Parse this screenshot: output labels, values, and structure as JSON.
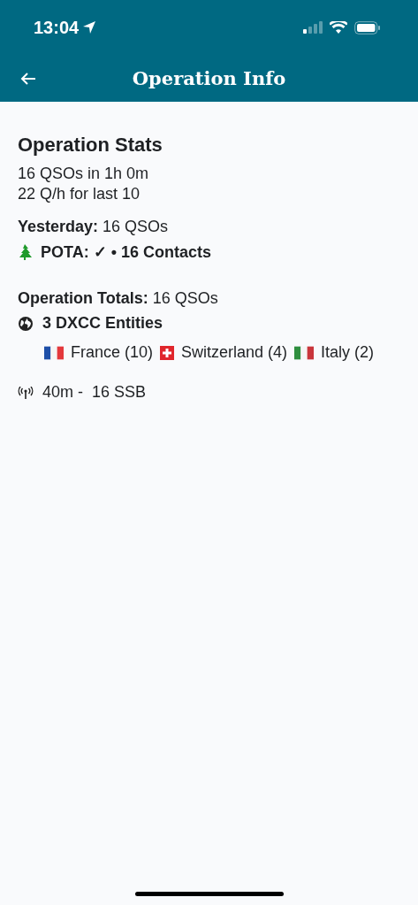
{
  "status_bar": {
    "time": "13:04"
  },
  "header": {
    "title": "Operation Info"
  },
  "stats": {
    "title": "Operation Stats",
    "lines": [
      "16 QSOs in 1h 0m",
      "22 Q/h for last 10"
    ]
  },
  "yesterday": {
    "summary": "**Yesterday:** 16 QSOs",
    "pota": "POTA: ✓ • 16 Contacts"
  },
  "totals": {
    "summary": "**Operation Totals:** 16 QSOs",
    "dxcc": "3 DXCC Entities",
    "countries": [
      {
        "kind": "tricolor_blue",
        "label": "France (10)"
      },
      {
        "kind": "cross",
        "label": "Switzerland (4)"
      },
      {
        "kind": "tricolor_green",
        "label": "Italy (2)"
      }
    ]
  },
  "bands": [
    {
      "label": "40m -  16 SSB"
    }
  ]
}
